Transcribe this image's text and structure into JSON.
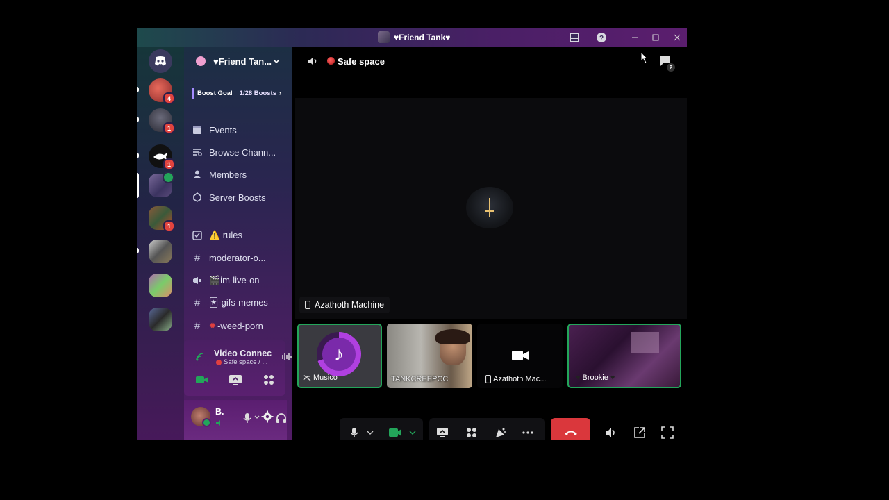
{
  "window": {
    "title": "♥Friend Tank♥"
  },
  "server": {
    "name": "♥Friend Tan...",
    "boost_goal_label": "Boost Goal",
    "boost_count": "1/28 Boosts"
  },
  "guild_badges": {
    "g1": "4",
    "g2": "1",
    "g3": "1",
    "g5": "1"
  },
  "menu_items": [
    {
      "label": "Events",
      "icon": "calendar-icon"
    },
    {
      "label": "Browse Chann...",
      "icon": "browse-channels-icon"
    },
    {
      "label": "Members",
      "icon": "members-icon"
    },
    {
      "label": "Server Boosts",
      "icon": "boost-icon"
    }
  ],
  "channels": [
    {
      "label": "⚠️ rules",
      "icon": "rules-icon"
    },
    {
      "label": "moderator-o...",
      "icon": "hash-icon"
    },
    {
      "label": "🎬im-live-on",
      "icon": "announcement-icon"
    },
    {
      "label": "🃏-gifs-memes",
      "icon": "hash-icon"
    },
    {
      "label": "-weed-porn",
      "icon": "hash-icon"
    }
  ],
  "voice": {
    "status": "Video Connec",
    "channel": "Safe space / ..."
  },
  "user": {
    "name": "B."
  },
  "call": {
    "channel_title": "Safe space",
    "focused_name": "Azathoth Machine",
    "participant_count": "2"
  },
  "tiles": [
    {
      "name": "Musico"
    },
    {
      "name": "TANKCREEPCC"
    },
    {
      "name": "Azathoth Mac..."
    },
    {
      "name": "Brookie"
    }
  ],
  "colors": {
    "accent_green": "#23a55a",
    "danger_red": "#da373c",
    "brand": "#5865f2"
  }
}
